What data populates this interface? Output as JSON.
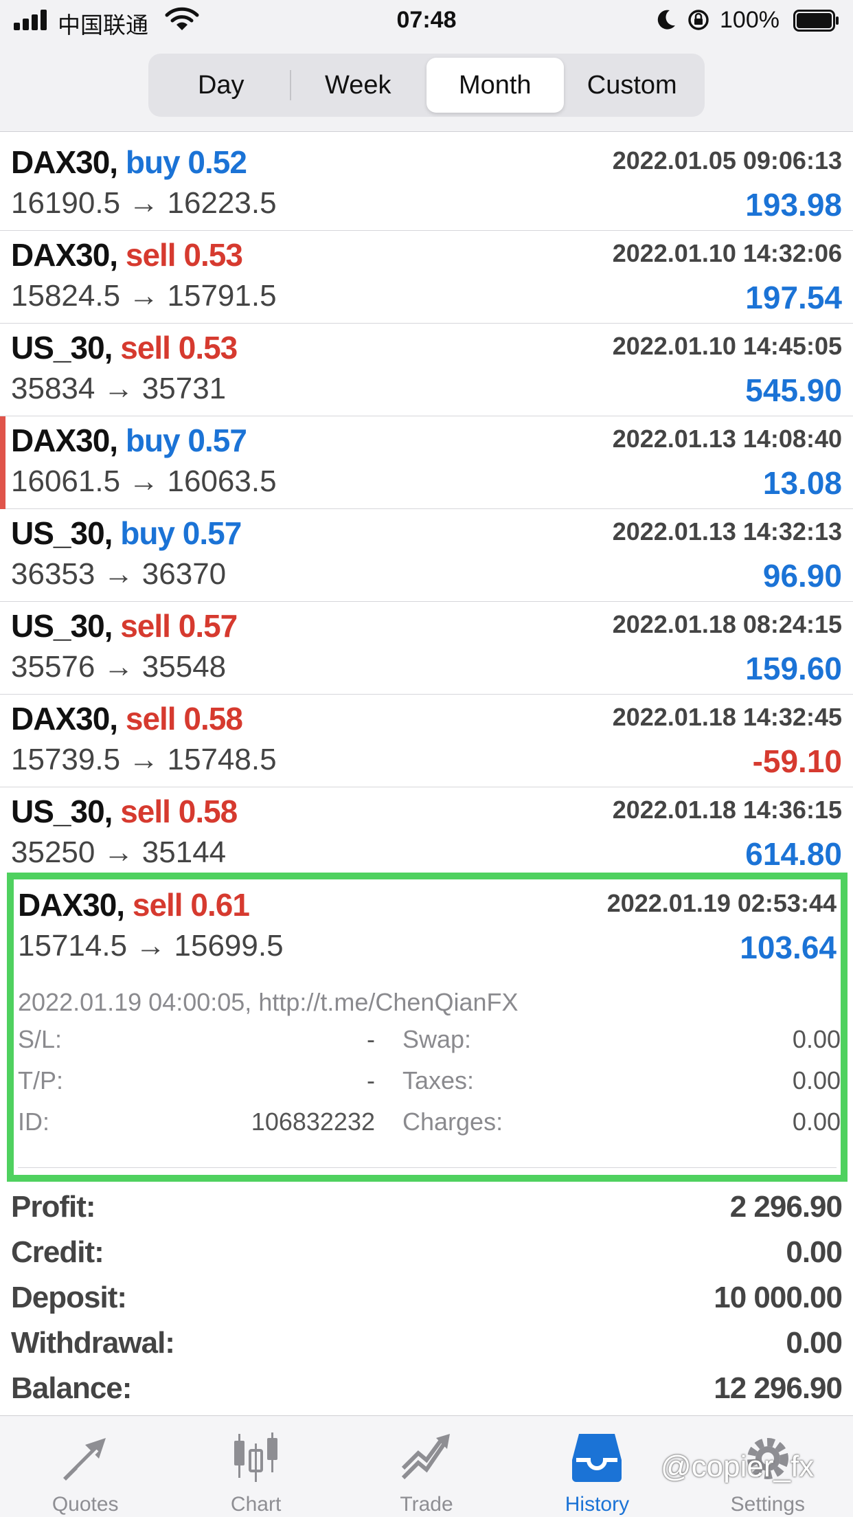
{
  "status_bar": {
    "carrier": "中国联通",
    "time": "07:48",
    "battery": "100%"
  },
  "period_tabs": [
    {
      "label": "Day",
      "active": false
    },
    {
      "label": "Week",
      "active": false
    },
    {
      "label": "Month",
      "active": true
    },
    {
      "label": "Custom",
      "active": false
    }
  ],
  "trades": [
    {
      "symbol": "DAX30,",
      "direction": "buy",
      "volume": "0.52",
      "time": "2022.01.05 09:06:13",
      "prices": "16190.5 → 16223.5",
      "profit": "193.98"
    },
    {
      "symbol": "DAX30,",
      "direction": "sell",
      "volume": "0.53",
      "time": "2022.01.10 14:32:06",
      "prices": "15824.5 → 15791.5",
      "profit": "197.54"
    },
    {
      "symbol": "US_30,",
      "direction": "sell",
      "volume": "0.53",
      "time": "2022.01.10 14:45:05",
      "prices": "35834 → 35731",
      "profit": "545.90"
    },
    {
      "symbol": "DAX30,",
      "direction": "buy",
      "volume": "0.57",
      "time": "2022.01.13 14:08:40",
      "prices": "16061.5 → 16063.5",
      "profit": "13.08"
    },
    {
      "symbol": "US_30,",
      "direction": "buy",
      "volume": "0.57",
      "time": "2022.01.13 14:32:13",
      "prices": "36353 → 36370",
      "profit": "96.90"
    },
    {
      "symbol": "US_30,",
      "direction": "sell",
      "volume": "0.57",
      "time": "2022.01.18 08:24:15",
      "prices": "35576 → 35548",
      "profit": "159.60"
    },
    {
      "symbol": "DAX30,",
      "direction": "sell",
      "volume": "0.58",
      "time": "2022.01.18 14:32:45",
      "prices": "15739.5 → 15748.5",
      "profit": "-59.10"
    },
    {
      "symbol": "US_30,",
      "direction": "sell",
      "volume": "0.58",
      "time": "2022.01.18 14:36:15",
      "prices": "35250 → 35144",
      "profit": "614.80"
    }
  ],
  "expanded_trade": {
    "symbol": "DAX30,",
    "direction": "sell",
    "volume": "0.61",
    "time": "2022.01.19 02:53:44",
    "prices": "15714.5 → 15699.5",
    "profit": "103.64",
    "comment": "2022.01.19 04:00:05, http://t.me/ChenQianFX",
    "details": [
      {
        "label1": "S/L:",
        "value1": "-",
        "label2": "Swap:",
        "value2": "0.00"
      },
      {
        "label1": "T/P:",
        "value1": "-",
        "label2": "Taxes:",
        "value2": "0.00"
      },
      {
        "label1": "ID:",
        "value1": "106832232",
        "label2": "Charges:",
        "value2": "0.00"
      }
    ]
  },
  "summary": [
    {
      "label": "Profit:",
      "value": "2 296.90"
    },
    {
      "label": "Credit:",
      "value": "0.00"
    },
    {
      "label": "Deposit:",
      "value": "10 000.00"
    },
    {
      "label": "Withdrawal:",
      "value": "0.00"
    },
    {
      "label": "Balance:",
      "value": "12 296.90"
    }
  ],
  "tab_bar": [
    {
      "label": "Quotes",
      "icon": "quotes-arrows-icon",
      "active": false
    },
    {
      "label": "Chart",
      "icon": "candlestick-icon",
      "active": false
    },
    {
      "label": "Trade",
      "icon": "trend-line-icon",
      "active": false
    },
    {
      "label": "History",
      "icon": "inbox-tray-icon",
      "active": true
    },
    {
      "label": "Settings",
      "icon": "gear-icon",
      "active": false
    }
  ],
  "watermark": "@copier_fx",
  "colors": {
    "accent": "#1b73d6",
    "sell": "#d63a2f",
    "highlight": "#4fd15f"
  }
}
